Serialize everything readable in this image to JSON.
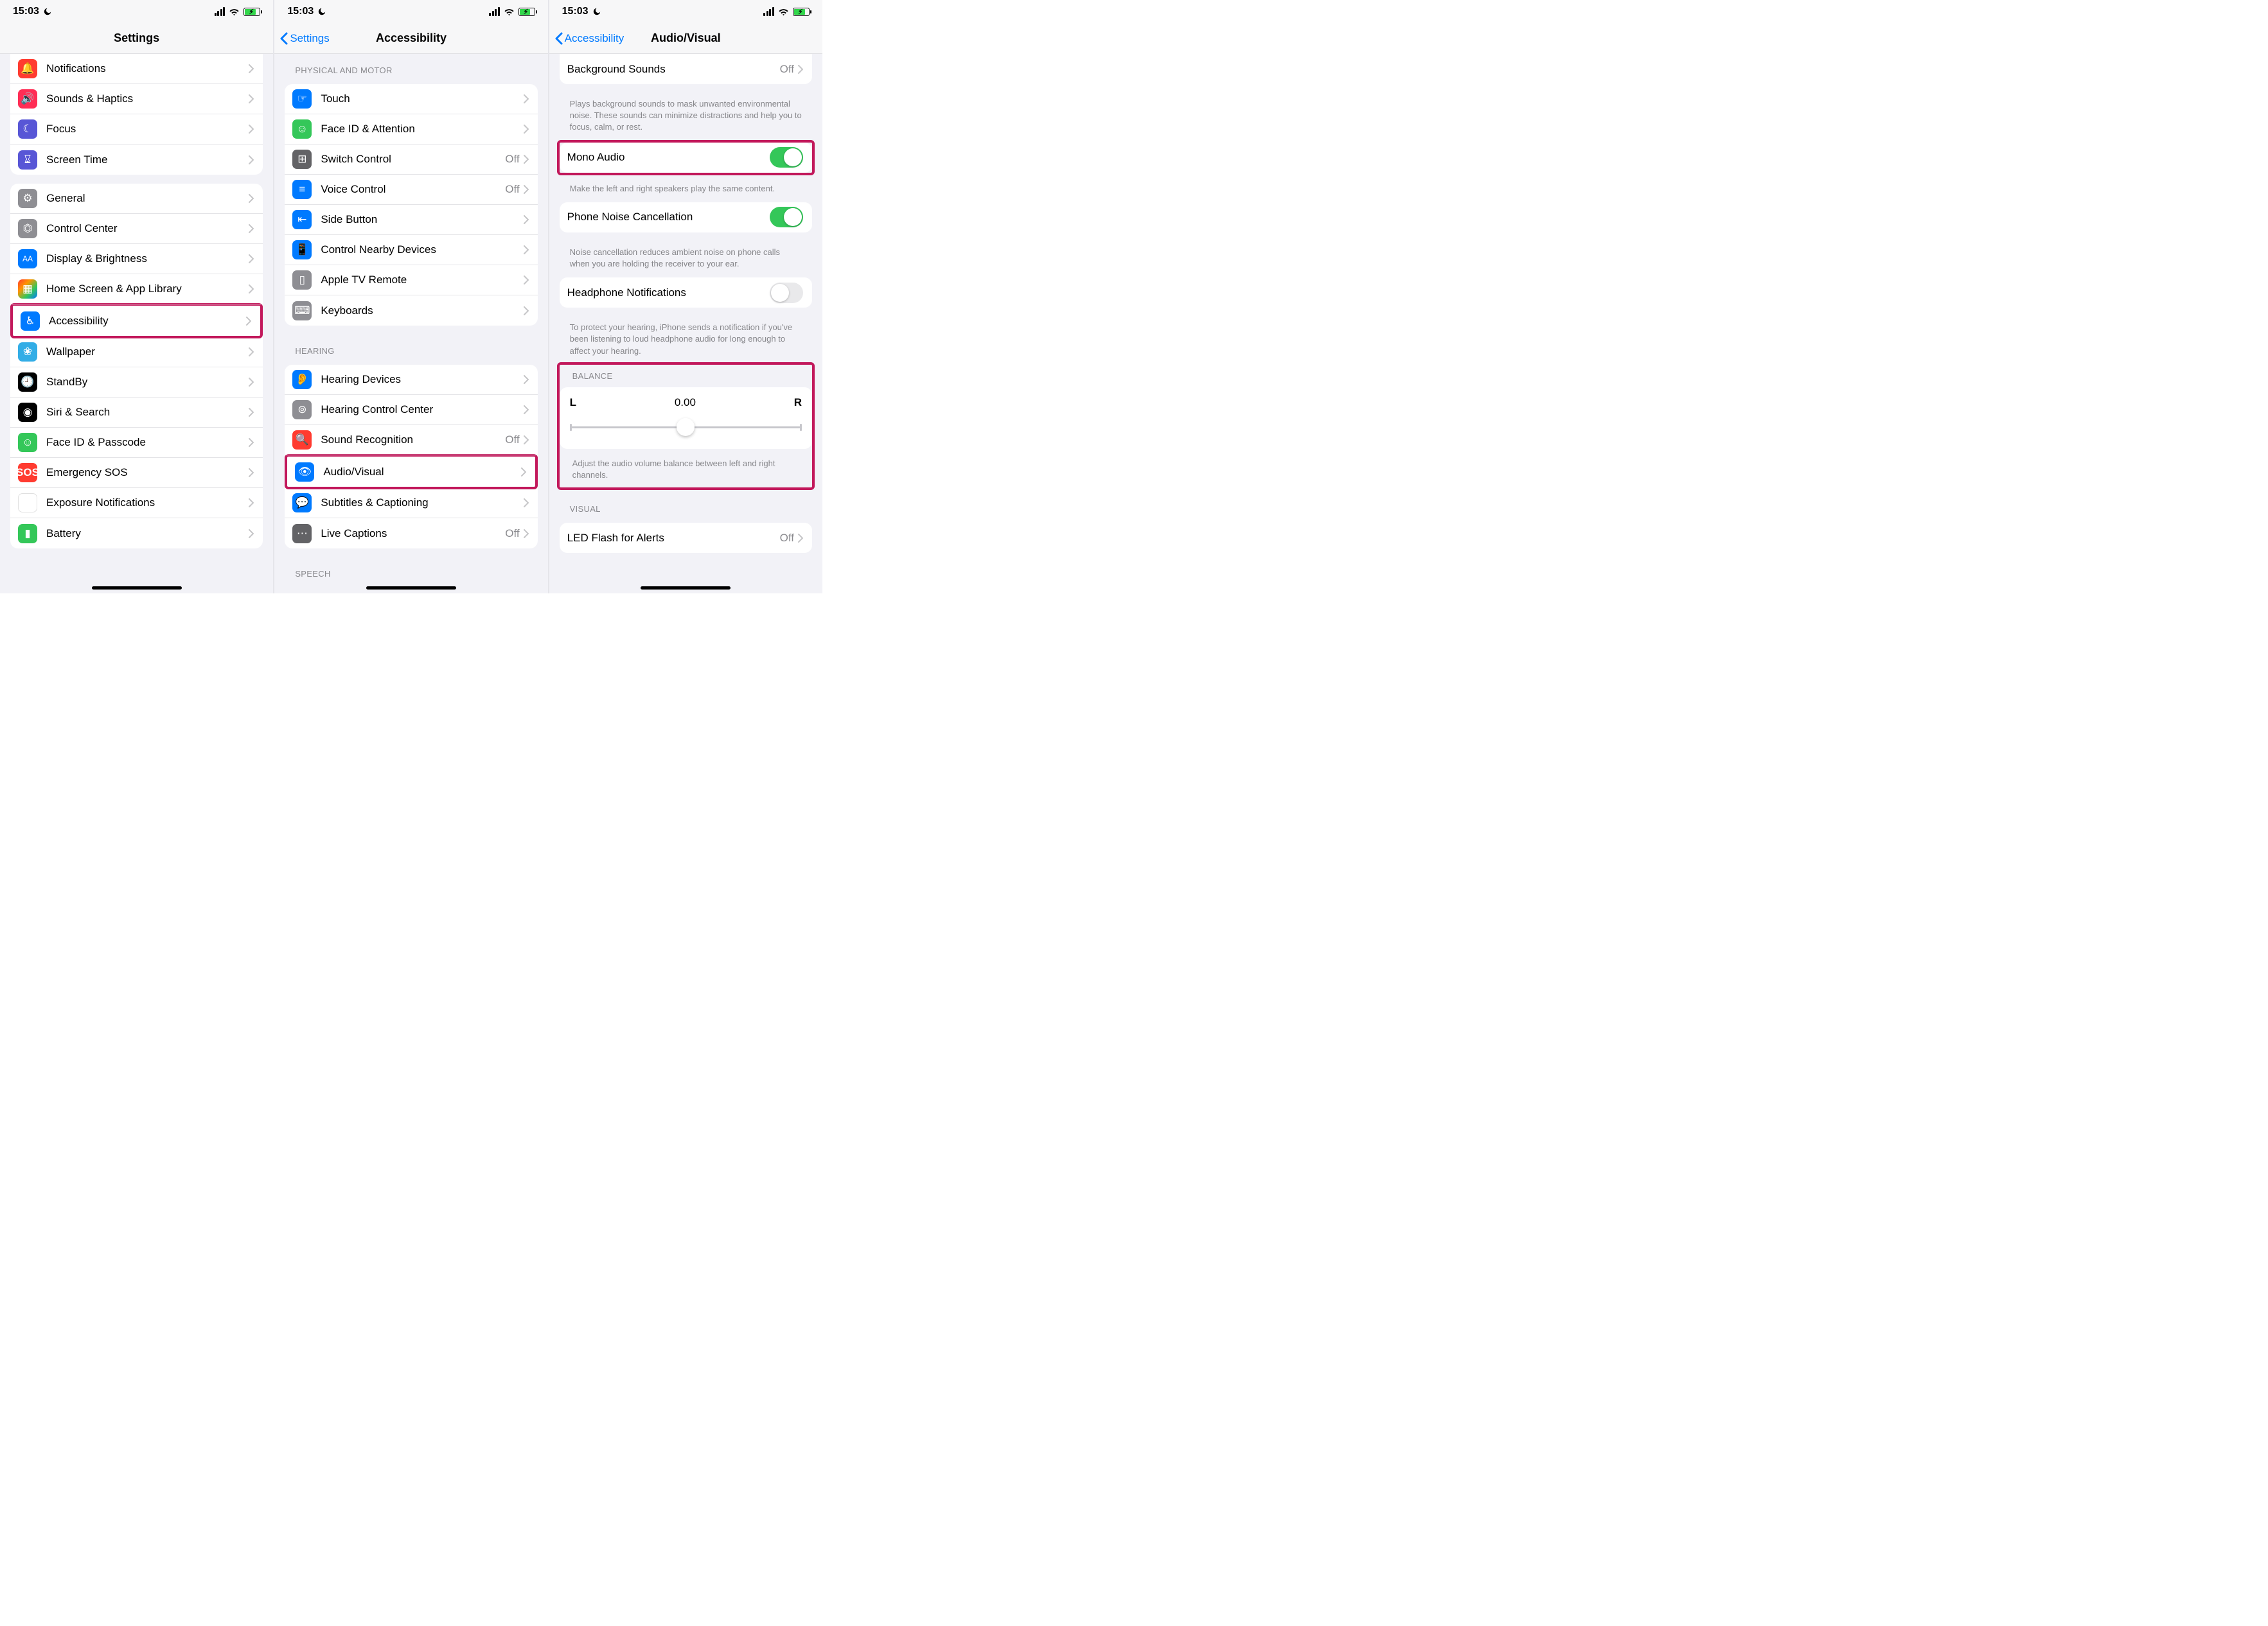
{
  "statusbar": {
    "time": "15:03"
  },
  "screen1": {
    "title": "Settings",
    "group1": [
      {
        "label": "Notifications",
        "icon": "bell-icon",
        "bg": "bg-red"
      },
      {
        "label": "Sounds & Haptics",
        "icon": "speaker-icon",
        "bg": "bg-pink"
      },
      {
        "label": "Focus",
        "icon": "moon-icon",
        "bg": "bg-purple"
      },
      {
        "label": "Screen Time",
        "icon": "hourglass-icon",
        "bg": "bg-purple"
      }
    ],
    "group2": [
      {
        "label": "General",
        "icon": "gear-icon",
        "bg": "bg-gray"
      },
      {
        "label": "Control Center",
        "icon": "switches-icon",
        "bg": "bg-gray"
      },
      {
        "label": "Display & Brightness",
        "icon": "text-size-icon",
        "bg": "bg-blue"
      },
      {
        "label": "Home Screen & App Library",
        "icon": "grid-icon",
        "bg": "bg-multicolor"
      },
      {
        "label": "Accessibility",
        "icon": "accessibility-icon",
        "bg": "bg-blue",
        "highlight": true
      },
      {
        "label": "Wallpaper",
        "icon": "flower-icon",
        "bg": "bg-cyan"
      },
      {
        "label": "StandBy",
        "icon": "clock-icon",
        "bg": "bg-black"
      },
      {
        "label": "Siri & Search",
        "icon": "siri-icon",
        "bg": "bg-black"
      },
      {
        "label": "Face ID & Passcode",
        "icon": "faceid-icon",
        "bg": "bg-green"
      },
      {
        "label": "Emergency SOS",
        "icon": "sos-icon",
        "bg": "bg-sos"
      },
      {
        "label": "Exposure Notifications",
        "icon": "exposure-icon",
        "bg": "bg-white"
      },
      {
        "label": "Battery",
        "icon": "battery-icon",
        "bg": "bg-green"
      }
    ]
  },
  "screen2": {
    "back": "Settings",
    "title": "Accessibility",
    "sections": [
      {
        "header": "Physical and Motor",
        "rows": [
          {
            "label": "Touch",
            "icon": "hand-icon",
            "bg": "bg-blue"
          },
          {
            "label": "Face ID & Attention",
            "icon": "faceid-icon",
            "bg": "bg-green"
          },
          {
            "label": "Switch Control",
            "icon": "switch-icon",
            "bg": "bg-darkgray",
            "value": "Off"
          },
          {
            "label": "Voice Control",
            "icon": "voice-icon",
            "bg": "bg-blue",
            "value": "Off"
          },
          {
            "label": "Side Button",
            "icon": "side-button-icon",
            "bg": "bg-blue"
          },
          {
            "label": "Control Nearby Devices",
            "icon": "nearby-icon",
            "bg": "bg-blue"
          },
          {
            "label": "Apple TV Remote",
            "icon": "remote-icon",
            "bg": "bg-gray"
          },
          {
            "label": "Keyboards",
            "icon": "keyboard-icon",
            "bg": "bg-gray"
          }
        ]
      },
      {
        "header": "Hearing",
        "rows": [
          {
            "label": "Hearing Devices",
            "icon": "ear-icon",
            "bg": "bg-blue"
          },
          {
            "label": "Hearing Control Center",
            "icon": "hearing-cc-icon",
            "bg": "bg-gray"
          },
          {
            "label": "Sound Recognition",
            "icon": "sound-rec-icon",
            "bg": "bg-red",
            "value": "Off"
          },
          {
            "label": "Audio/Visual",
            "icon": "audio-visual-icon",
            "bg": "bg-blue",
            "highlight": true
          },
          {
            "label": "Subtitles & Captioning",
            "icon": "subtitles-icon",
            "bg": "bg-blue"
          },
          {
            "label": "Live Captions",
            "icon": "live-captions-icon",
            "bg": "bg-darkgray",
            "value": "Off"
          }
        ]
      },
      {
        "header": "Speech",
        "rows": []
      }
    ]
  },
  "screen3": {
    "back": "Accessibility",
    "title": "Audio/Visual",
    "bgSounds": {
      "label": "Background Sounds",
      "value": "Off",
      "footer": "Plays background sounds to mask unwanted environmental noise. These sounds can minimize distractions and help you to focus, calm, or rest."
    },
    "mono": {
      "label": "Mono Audio",
      "on": true,
      "footer": "Make the left and right speakers play the same content."
    },
    "noise": {
      "label": "Phone Noise Cancellation",
      "on": true,
      "footer": "Noise cancellation reduces ambient noise on phone calls when you are holding the receiver to your ear."
    },
    "headphone": {
      "label": "Headphone Notifications",
      "on": false,
      "footer": "To protect your hearing, iPhone sends a notification if you've been listening to loud headphone audio for long enough to affect your hearing."
    },
    "balance": {
      "header": "Balance",
      "L": "L",
      "R": "R",
      "value": "0.00",
      "footer": "Adjust the audio volume balance between left and right channels."
    },
    "visual": {
      "header": "Visual",
      "led": {
        "label": "LED Flash for Alerts",
        "value": "Off"
      }
    }
  }
}
